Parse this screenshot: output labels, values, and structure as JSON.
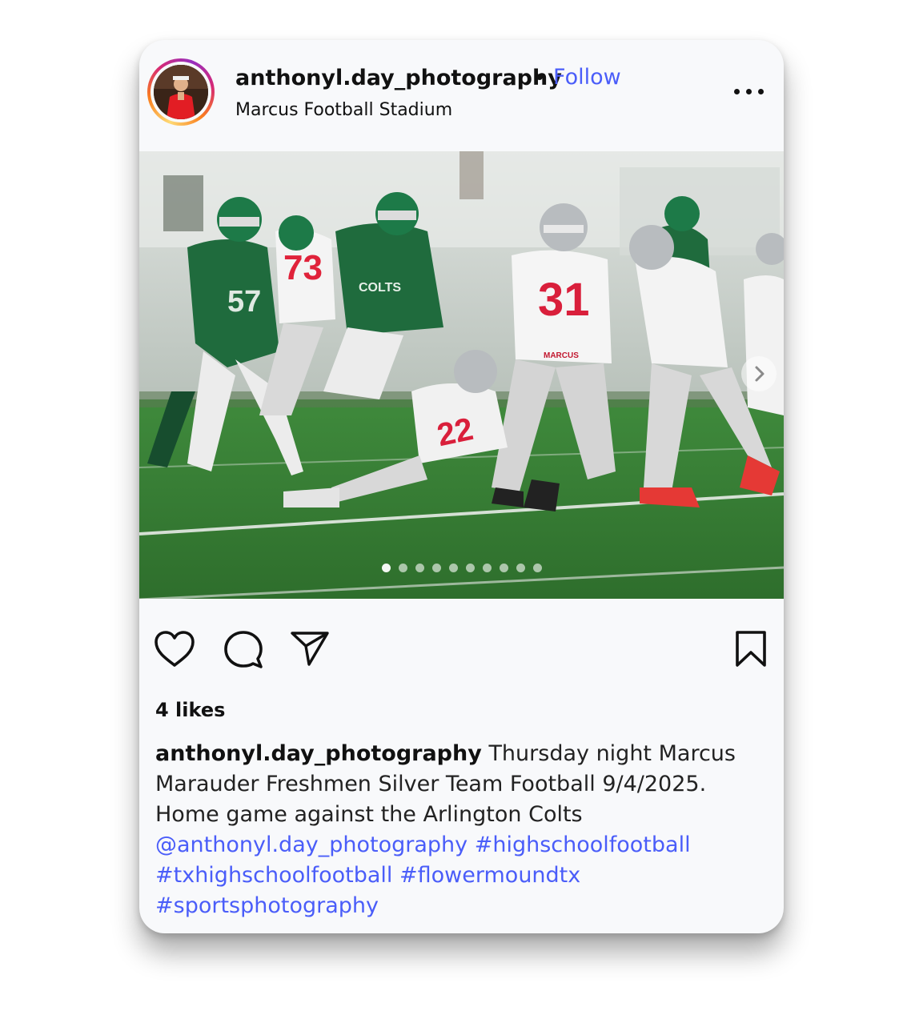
{
  "post": {
    "username": "anthonyl.day_photography",
    "separator": "•",
    "follow_label": "Follow",
    "location": "Marcus Football Stadium",
    "carousel": {
      "total_slides": 10,
      "current_slide": 1
    },
    "likes_text": "4 likes",
    "caption": {
      "username": "anthonyl.day_photography",
      "text": "Thursday night Marcus Marauder Freshmen Silver Team Football 9/4/2025. Home game against the Arlington Colts",
      "tags": [
        "@anthonyl.day_photography",
        "#highschoolfootball",
        "#txhighschoolfootball",
        "#flowermoundtx",
        "#sportsphotography"
      ]
    },
    "jerseys": [
      "73",
      "31",
      "22",
      "57",
      "COLTS",
      "MARCUS"
    ]
  },
  "icons": {
    "more": "more-horizontal-icon",
    "like": "heart-icon",
    "comment": "comment-bubble-icon",
    "share": "paper-plane-icon",
    "save": "bookmark-icon",
    "next": "chevron-right-icon"
  },
  "colors": {
    "link": "#4a5df9",
    "text": "#111111",
    "card": "#f8f9fb"
  }
}
